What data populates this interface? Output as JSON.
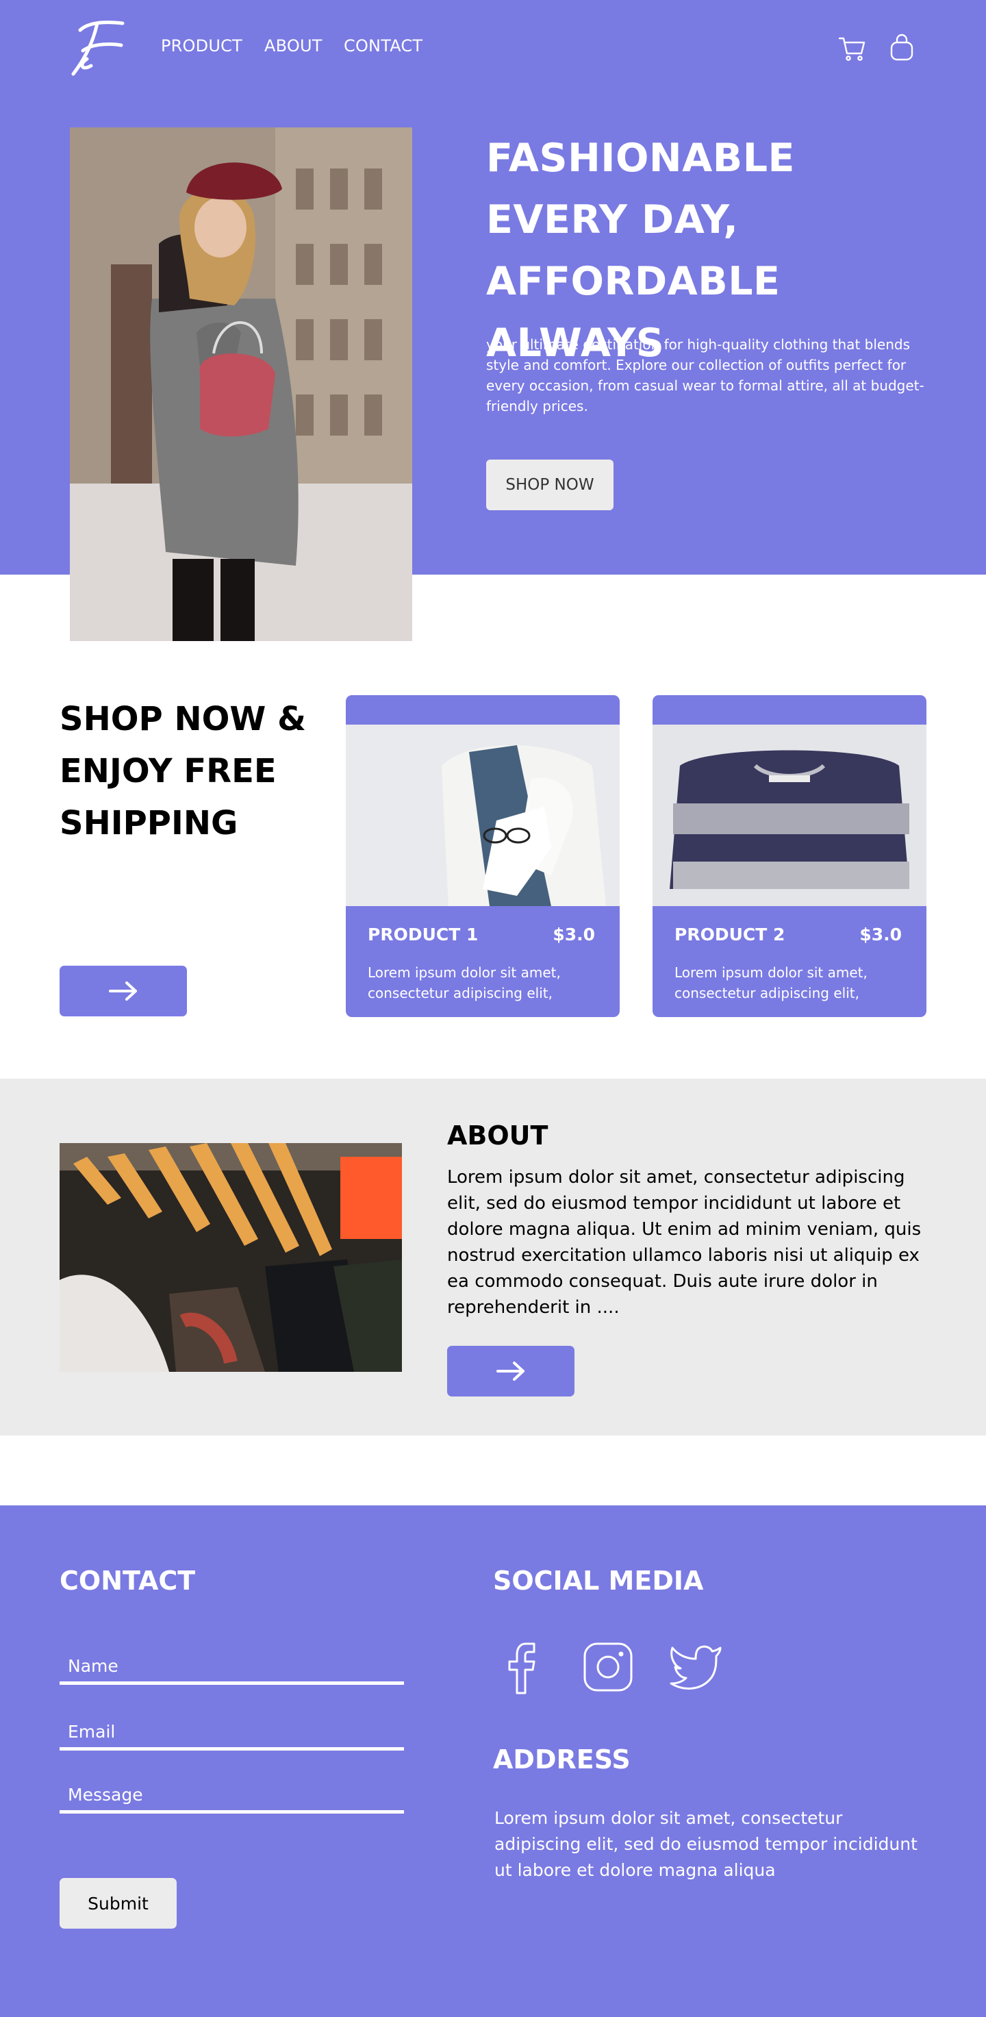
{
  "nav": {
    "links": [
      "PRODUCT",
      "ABOUT",
      "CONTACT"
    ]
  },
  "hero": {
    "title": "FASHIONABLE EVERY DAY, AFFORDABLE ALWAYS",
    "description": "your ultimate destination for high-quality clothing that blends style and comfort. Explore our collection of outfits perfect for every occasion, from casual wear to formal attire, all at budget-friendly prices.",
    "cta": "SHOP NOW"
  },
  "promo": {
    "title": "SHOP NOW & ENJOY FREE SHIPPING"
  },
  "products": [
    {
      "name": "PRODUCT 1",
      "price": "$3.0",
      "description": "Lorem ipsum dolor sit amet, consectetur adipiscing elit,"
    },
    {
      "name": "PRODUCT 2",
      "price": "$3.0",
      "description": "Lorem ipsum dolor sit amet, consectetur adipiscing elit,"
    }
  ],
  "about": {
    "title": "ABOUT",
    "text": "Lorem ipsum dolor sit amet, consectetur adipiscing elit, sed do eiusmod tempor incididunt ut labore et dolore magna aliqua. Ut enim ad minim veniam, quis nostrud exercitation ullamco laboris nisi ut aliquip ex ea commodo consequat. Duis aute irure dolor in reprehenderit in ...."
  },
  "contact": {
    "title": "CONTACT",
    "name_placeholder": "Name",
    "email_placeholder": "Email",
    "message_placeholder": "Message",
    "submit": "Submit"
  },
  "social": {
    "title": "SOCIAL MEDIA",
    "icons": [
      "facebook-icon",
      "instagram-icon",
      "twitter-icon"
    ]
  },
  "address": {
    "title": "ADDRESS",
    "text": "Lorem ipsum dolor sit amet, consectetur adipiscing elit, sed do eiusmod tempor incididunt ut labore et dolore magna aliqua"
  },
  "colors": {
    "brand": "#7a7ae3",
    "light_gray": "#ebebeb"
  }
}
